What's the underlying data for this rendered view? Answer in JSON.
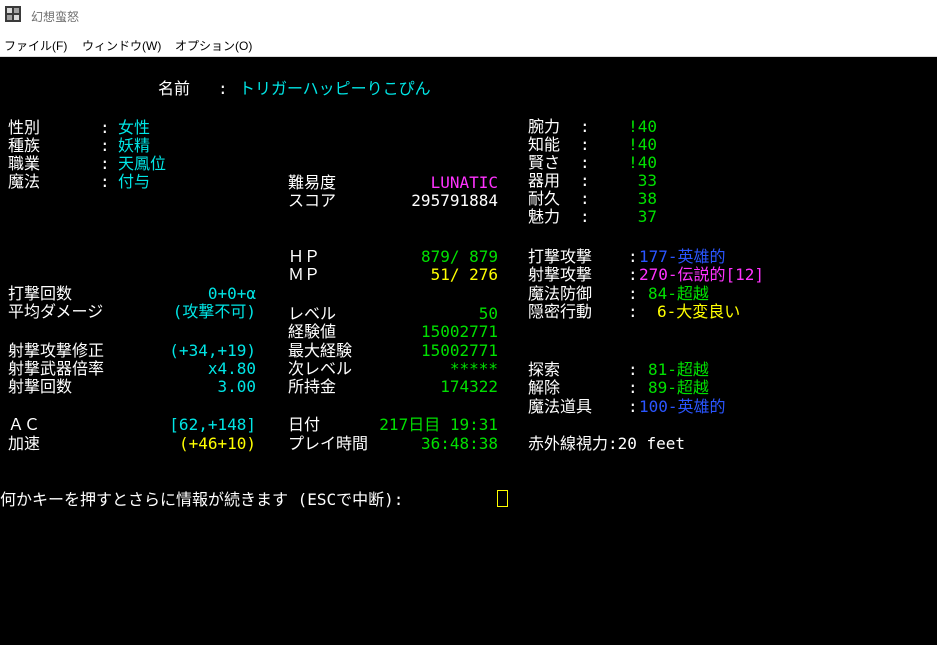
{
  "window": {
    "title": "幻想蛮怒",
    "icon": "game-app-icon"
  },
  "menu": [
    "ファイル(F)",
    "ウィンドウ(W)",
    "オプション(O)"
  ],
  "terminal": {
    "name_label": "名前",
    "colon": ":",
    "name_value": "トリガーハッピーりこぴん",
    "profile": [
      {
        "label": "性別",
        "value": "女性"
      },
      {
        "label": "種族",
        "value": "妖精"
      },
      {
        "label": "職業",
        "value": "天鳳位"
      },
      {
        "label": "魔法",
        "value": "付与"
      }
    ],
    "difficulty": {
      "label": "難易度",
      "value": "LUNATIC"
    },
    "score": {
      "label": "スコア",
      "value": "295791884"
    },
    "stats": [
      {
        "label": "腕力",
        "value": "!40"
      },
      {
        "label": "知能",
        "value": "!40"
      },
      {
        "label": "賢さ",
        "value": "!40"
      },
      {
        "label": "器用",
        "value": "33"
      },
      {
        "label": "耐久",
        "value": "38"
      },
      {
        "label": "魅力",
        "value": "37"
      }
    ],
    "hp": {
      "label": "ＨＰ",
      "value": "879/ 879"
    },
    "mp": {
      "label": "ＭＰ",
      "value": "51/ 276"
    },
    "skills_top": [
      {
        "label": "打撃攻撃",
        "value": "177-英雄的"
      },
      {
        "label": "射撃攻撃",
        "value": "270-伝説的[12]"
      },
      {
        "label": "魔法防御",
        "value": "84-超越"
      },
      {
        "label": "隠密行動",
        "value": "6-大変良い"
      }
    ],
    "melee": [
      {
        "label": "打撃回数",
        "value": "0+0+α"
      },
      {
        "label": "平均ダメージ",
        "value": "(攻撃不可)"
      }
    ],
    "level": {
      "label": "レベル",
      "value": "50"
    },
    "exp": {
      "label": "経験値",
      "value": "15002771"
    },
    "max_exp": {
      "label": "最大経験",
      "value": "15002771"
    },
    "next_level": {
      "label": "次レベル",
      "value": "*****"
    },
    "gold": {
      "label": "所持金",
      "value": "174322"
    },
    "ranged": [
      {
        "label": "射撃攻撃修正",
        "value": "(+34,+19)"
      },
      {
        "label": "射撃武器倍率",
        "value": "x4.80"
      },
      {
        "label": "射撃回数",
        "value": "3.00"
      }
    ],
    "skills_bottom": [
      {
        "label": "探索",
        "value": "81-超越"
      },
      {
        "label": "解除",
        "value": "89-超越"
      },
      {
        "label": "魔法道具",
        "value": "100-英雄的"
      }
    ],
    "ac": {
      "label": "ＡＣ",
      "value": "[62,+148]"
    },
    "speed": {
      "label": "加速",
      "value": "(+46+10)"
    },
    "date": {
      "label": "日付",
      "value": "217日目 19:31"
    },
    "playtime": {
      "label": "プレイ時間",
      "value": "36:48:38"
    },
    "infravision": "赤外線視力:20 feet",
    "prompt": "何かキーを押すとさらに情報が続きます (ESCで中断):"
  },
  "colors": {
    "background": "#000000",
    "label": "#ffffff",
    "cyan": "#00e5e5",
    "green": "#00e000",
    "yellow": "#ffff00",
    "magenta": "#ff33ff",
    "blue": "#2a55ff"
  }
}
